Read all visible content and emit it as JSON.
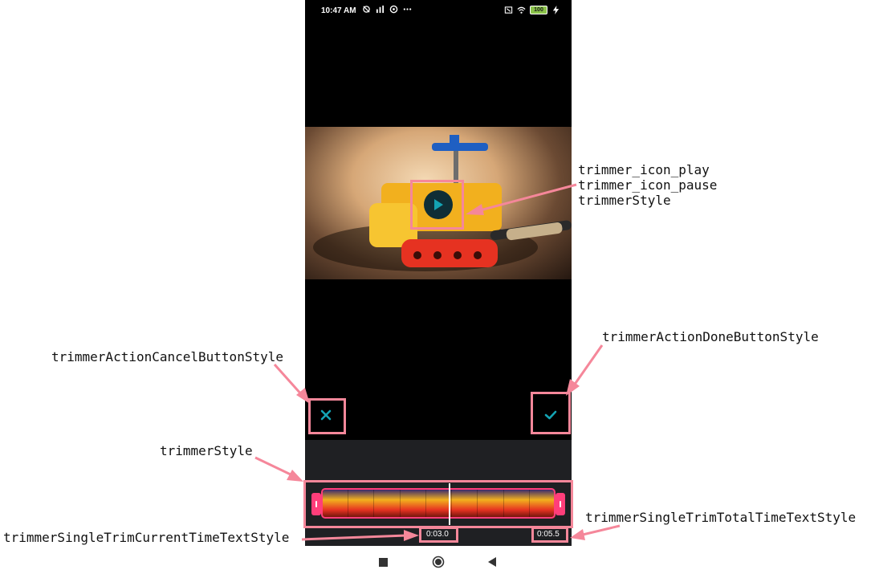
{
  "status_bar": {
    "time": "10:47 AM",
    "battery": "100"
  },
  "trimmer": {
    "current_time": "0:03.0",
    "total_time": "0:05.5",
    "frame_count": 9
  },
  "colors": {
    "accent": "#14a3b3",
    "handle": "#ff3e7a",
    "annotation": "#f5879a",
    "panel_bg": "#1f2023"
  },
  "annotations": {
    "play_icon_lines": [
      "trimmer_icon_play",
      "trimmer_icon_pause",
      "trimmerStyle"
    ],
    "done_button": "trimmerActionDoneButtonStyle",
    "cancel_button": "trimmerActionCancelButtonStyle",
    "trimmer_style": "trimmerStyle",
    "current_time_text": "trimmerSingleTrimCurrentTimeTextStyle",
    "total_time_text": "trimmerSingleTrimTotalTimeTextStyle"
  },
  "icons": {
    "play": "play-icon",
    "cancel": "close-icon",
    "done": "checkmark-icon",
    "nav_recents": "square-icon",
    "nav_home": "circle-icon",
    "nav_back": "triangle-back-icon"
  }
}
